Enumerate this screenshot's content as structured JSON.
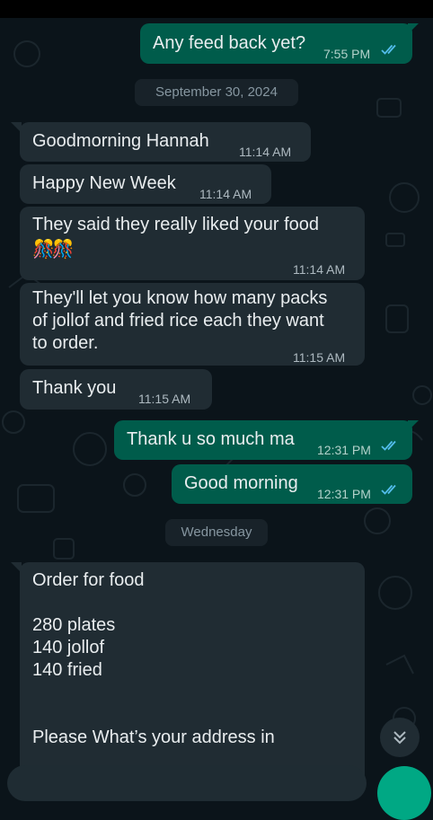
{
  "messages": [
    {
      "text": "Any feed back yet?",
      "time": "7:55 PM",
      "direction": "outgoing",
      "status": "read"
    },
    {
      "text": "Goodmorning Hannah",
      "time": "11:14 AM",
      "direction": "incoming"
    },
    {
      "text": "Happy New Week",
      "time": "11:14 AM",
      "direction": "incoming"
    },
    {
      "text": "They said they really liked your food",
      "emoji": "🎊🎊",
      "time": "11:14 AM",
      "direction": "incoming"
    },
    {
      "text": "They'll let you know how many packs\nof jollof and fried rice each they want\nto order.",
      "time": "11:15 AM",
      "direction": "incoming"
    },
    {
      "text": "Thank you",
      "time": "11:15 AM",
      "direction": "incoming"
    },
    {
      "text": "Thank u so much ma",
      "time": "12:31 PM",
      "direction": "outgoing",
      "status": "read"
    },
    {
      "text": "Good morning",
      "time": "12:31 PM",
      "direction": "outgoing",
      "status": "read"
    },
    {
      "text": "Order for food\n\n280 plates\n140 jollof\n140 fried\n\n\nPlease What’s your address in",
      "direction": "incoming"
    }
  ],
  "dates": [
    "September 30, 2024",
    "Wednesday"
  ],
  "colors": {
    "background": "#0b141a",
    "incoming_bubble": "#202c33",
    "outgoing_bubble": "#005c4b",
    "read_tick": "#53bdeb",
    "fab": "#00a884"
  },
  "icons": {
    "read_receipt": "double-check-icon",
    "scroll_down": "chevrons-down-icon"
  }
}
